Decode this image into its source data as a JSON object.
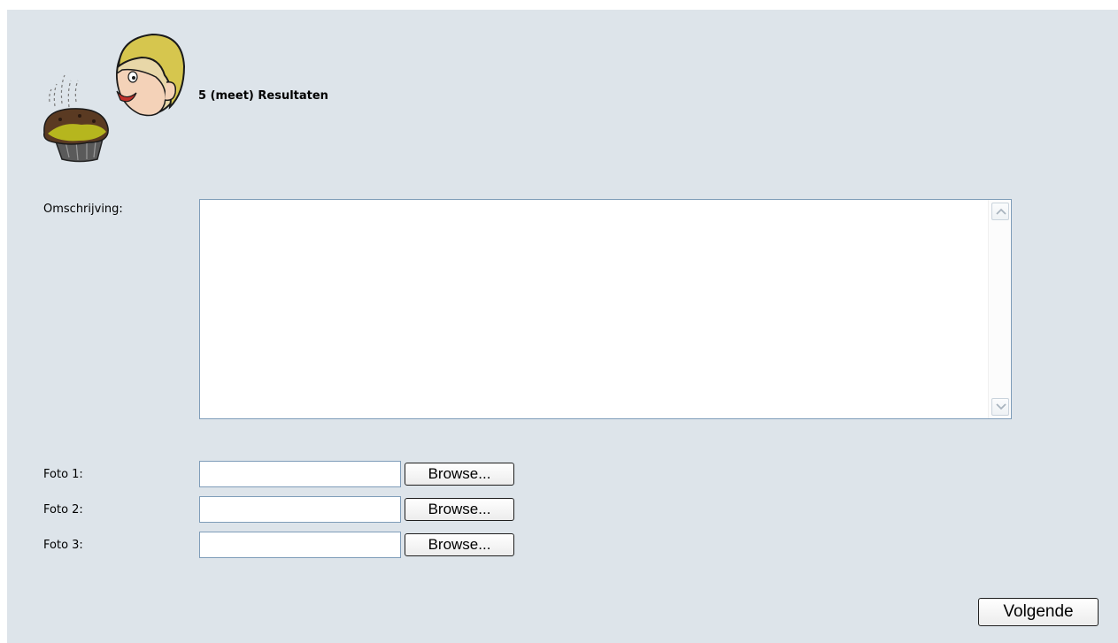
{
  "header": {
    "title": "5 (meet) Resultaten",
    "mascot_icon": "chef-mascot-with-muffin-icon"
  },
  "form": {
    "description": {
      "label": "Omschrijving:",
      "value": ""
    },
    "photos": [
      {
        "label": "Foto 1:",
        "value": "",
        "button_label": "Browse..."
      },
      {
        "label": "Foto 2:",
        "value": "",
        "button_label": "Browse..."
      },
      {
        "label": "Foto 3:",
        "value": "",
        "button_label": "Browse..."
      }
    ],
    "next_button_label": "Volgende"
  },
  "colors": {
    "panel_background": "#dde4ea",
    "field_border": "#7f9db9"
  }
}
